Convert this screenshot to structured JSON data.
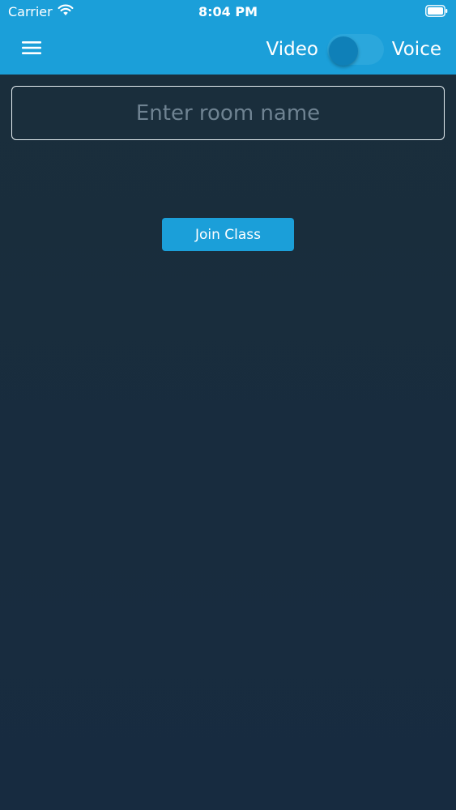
{
  "status_bar": {
    "carrier": "Carrier",
    "time": "8:04 PM",
    "wifi_icon": "wifi-icon",
    "battery_icon": "battery-icon"
  },
  "nav": {
    "menu_icon": "hamburger-menu-icon",
    "mode_left": "Video",
    "mode_right": "Voice",
    "toggle_on": false
  },
  "room": {
    "placeholder": "Enter room name",
    "value": ""
  },
  "join": {
    "label": "Join Class"
  },
  "colors": {
    "accent": "#1b9fd9",
    "background_top": "#1a2e3b",
    "background_bottom": "#172b40",
    "placeholder": "#6f8392"
  }
}
